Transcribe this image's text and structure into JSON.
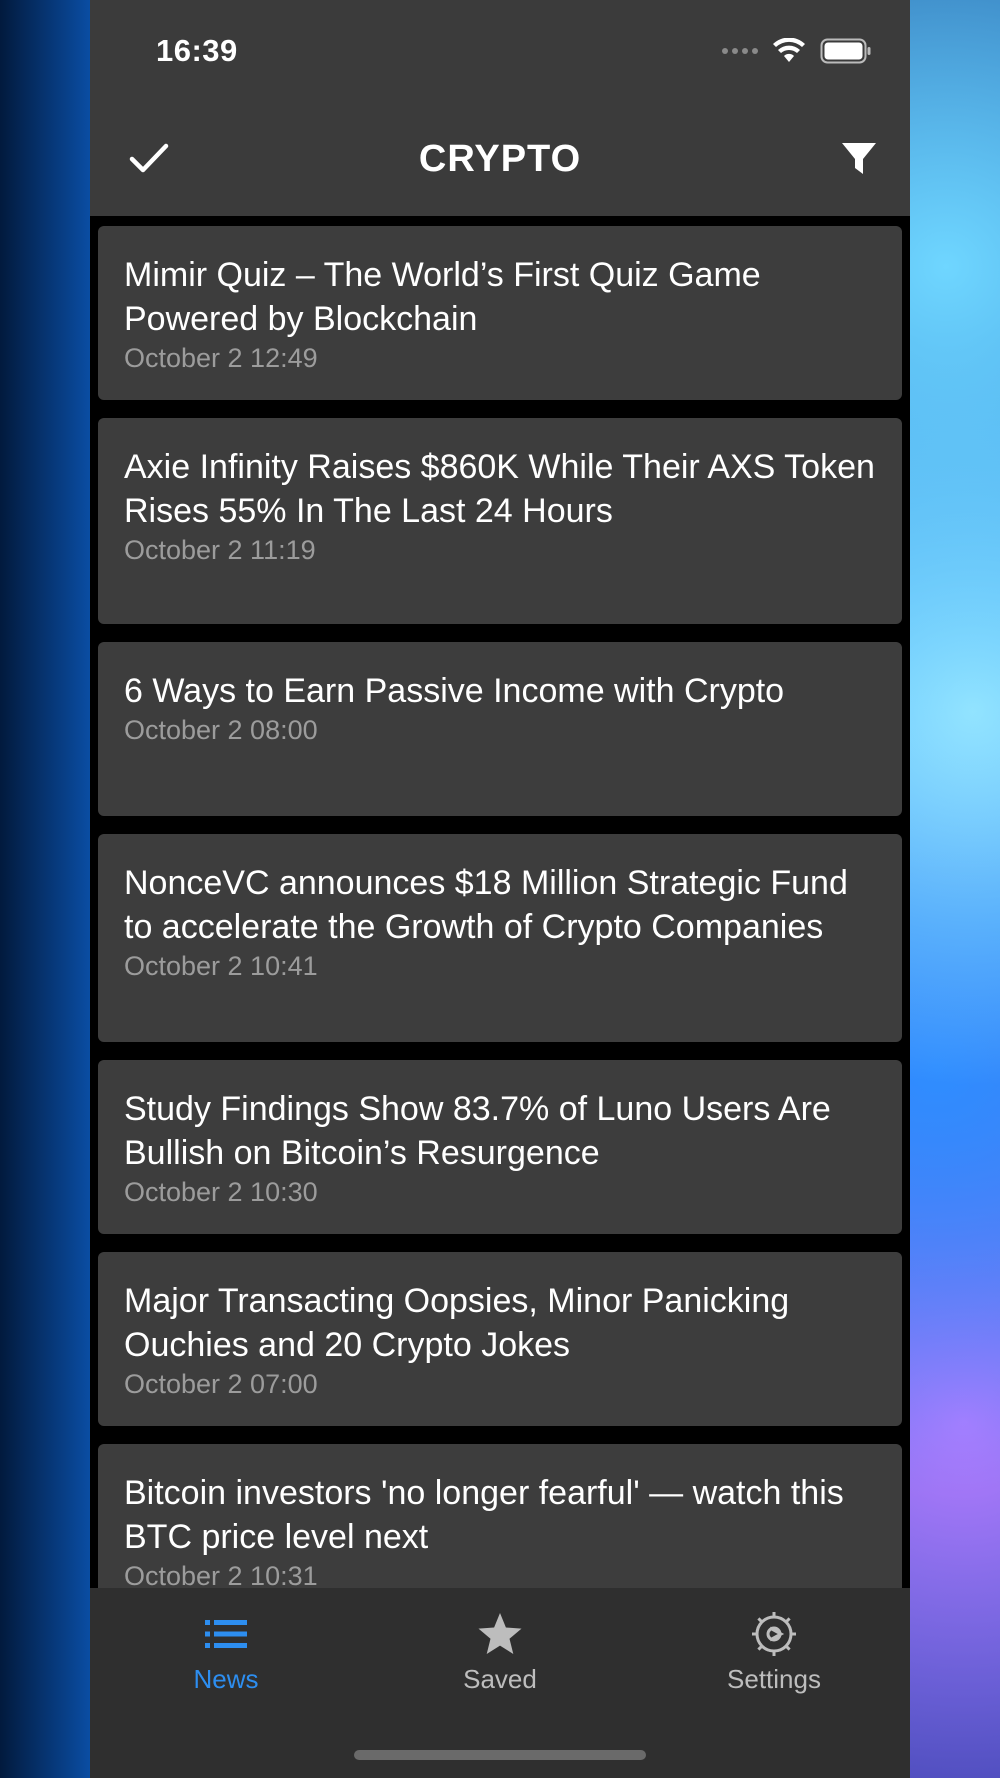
{
  "status_bar": {
    "time": "16:39",
    "icons": [
      "signal-dots-icon",
      "wifi-icon",
      "battery-icon"
    ]
  },
  "navbar": {
    "title": "CRYPTO",
    "left_icon": "checkmark-icon",
    "right_icon": "filter-icon"
  },
  "articles": [
    {
      "title": "Mimir Quiz – The World’s First Quiz Game Powered by Blockchain",
      "date": "October 2 12:49"
    },
    {
      "title": "Axie Infinity Raises $860K While Their AXS Token Rises 55% In The Last 24 Hours",
      "date": "October 2 11:19"
    },
    {
      "title": "6 Ways to Earn Passive Income with Crypto",
      "date": "October 2 08:00"
    },
    {
      "title": "NonceVC announces $18 Million Strategic Fund to accelerate the Growth of Crypto Companies",
      "date": "October 2 10:41"
    },
    {
      "title": "Study Findings Show 83.7% of Luno Users Are Bullish on Bitcoin’s Resurgence",
      "date": "October 2 10:30"
    },
    {
      "title": "Major Transacting Oopsies, Minor Panicking Ouchies and 20 Crypto Jokes",
      "date": "October 2 07:00"
    },
    {
      "title": "Bitcoin investors 'no longer fearful' — watch this BTC price level next",
      "date": "October 2 10:31"
    }
  ],
  "tabbar": {
    "tabs": [
      {
        "label": "News",
        "icon": "list-icon",
        "active": true
      },
      {
        "label": "Saved",
        "icon": "star-icon",
        "active": false
      },
      {
        "label": "Settings",
        "icon": "gear-icon",
        "active": false
      }
    ]
  },
  "colors": {
    "active_tab": "#2d8ef0",
    "inactive_tab": "#bdbdbd",
    "card_bg": "#3d3d3d",
    "bar_bg": "#3b3b3b"
  }
}
